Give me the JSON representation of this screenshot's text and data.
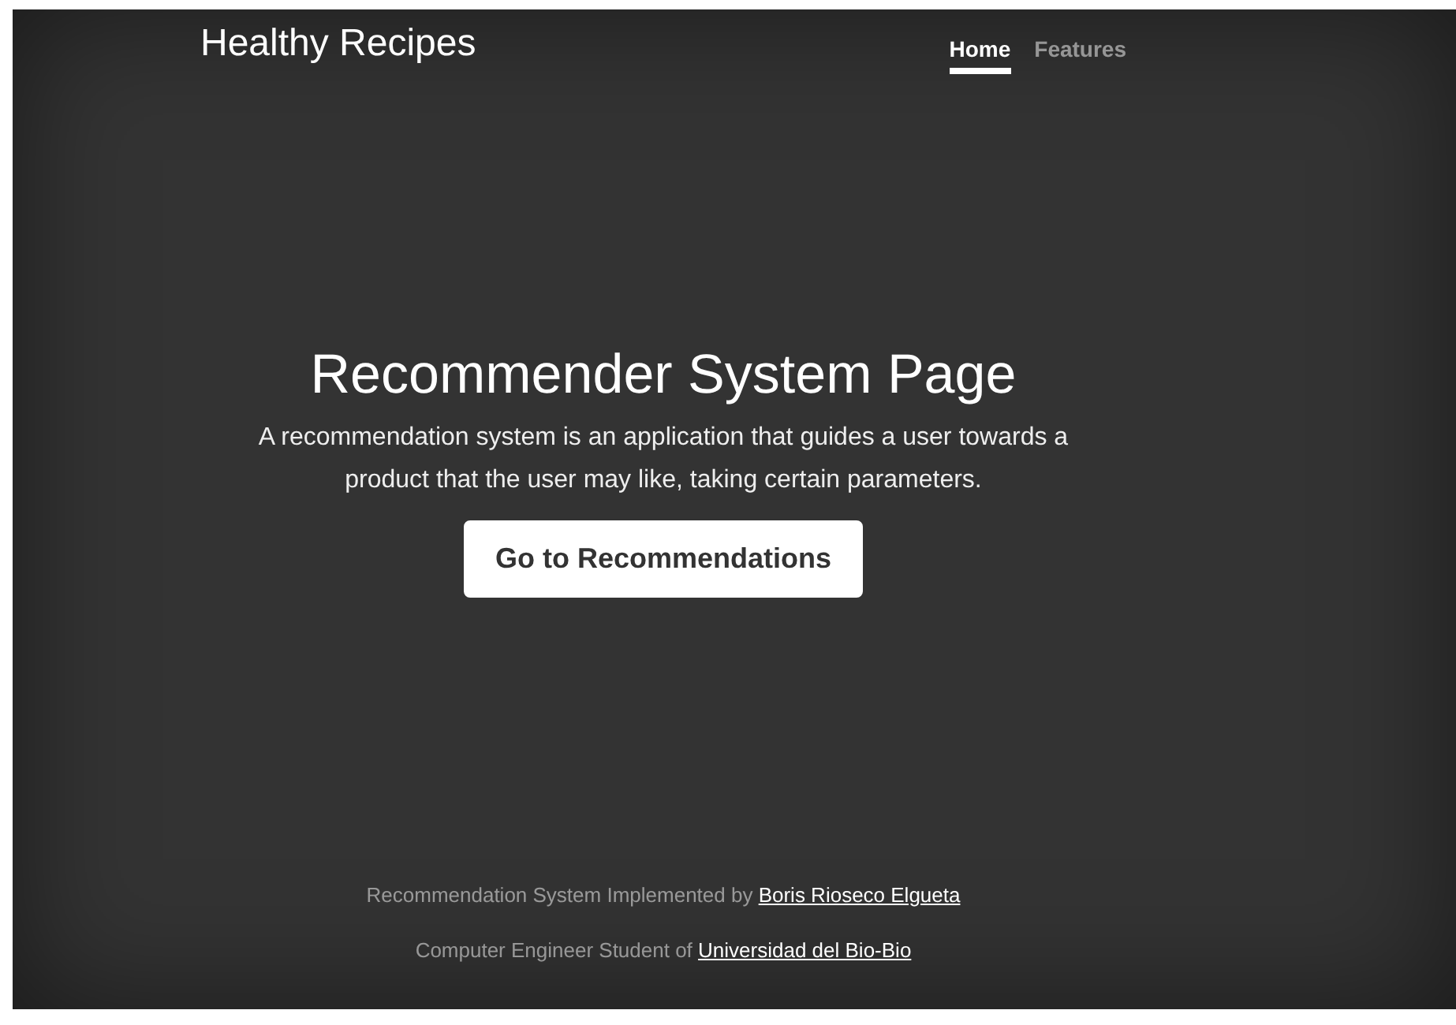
{
  "header": {
    "brand": "Healthy Recipes",
    "nav": [
      {
        "label": "Home",
        "selected": true
      },
      {
        "label": "Features",
        "selected": false
      }
    ]
  },
  "hero": {
    "title": "Recommender System Page",
    "lead": "A recommendation system is an application that guides a user towards a product that the user may like, taking certain parameters.",
    "button": "Go to Recommendations"
  },
  "footer": [
    {
      "text": "Recommendation System Implemented by",
      "link": "Boris Rioseco Elgueta"
    },
    {
      "text": "Computer Engineer Student of",
      "link": "Universidad del Bio-Bio"
    }
  ]
}
